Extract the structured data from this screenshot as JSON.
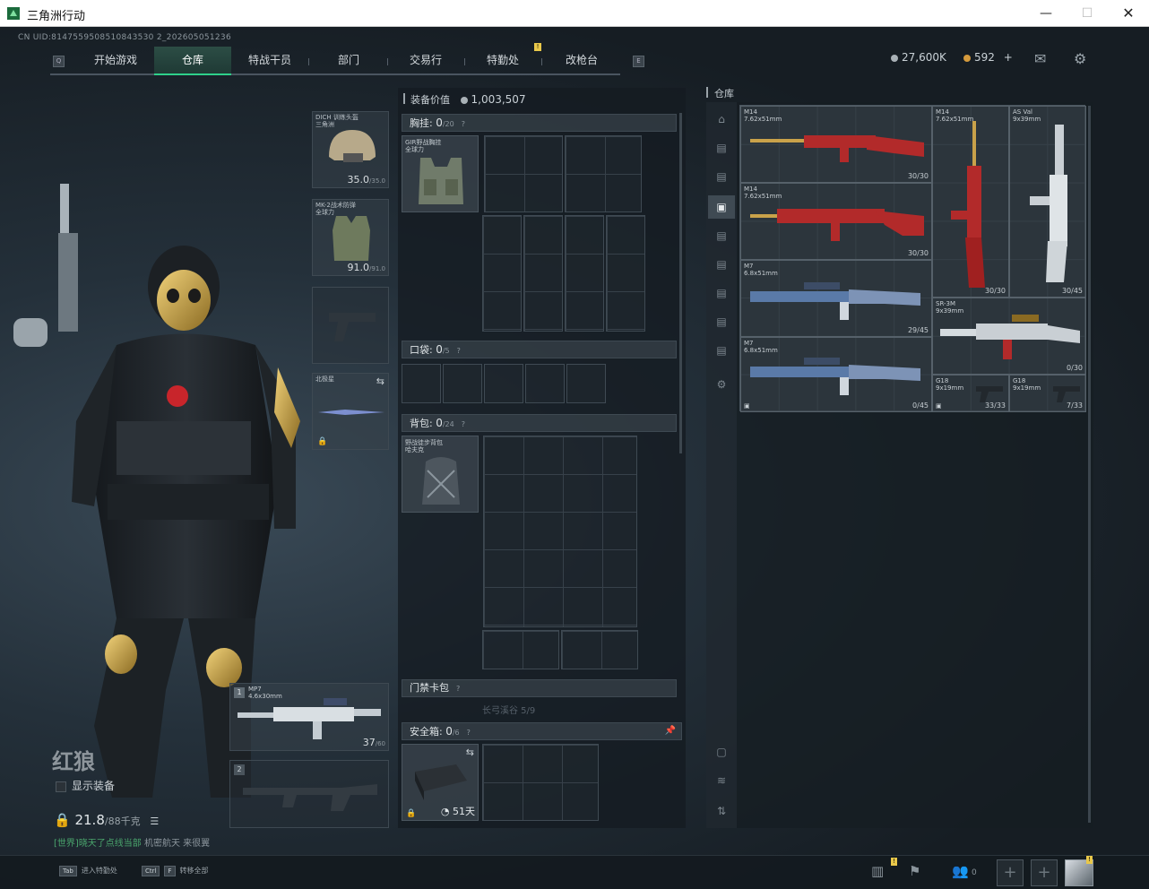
{
  "window": {
    "title": "三角洲行动",
    "min": "—",
    "max": "☐",
    "close": "✕"
  },
  "uid": "CN UID:8147559508510843530 2_202605051236",
  "nav": {
    "tabs": [
      "开始游戏",
      "仓库",
      "特战干员",
      "部门",
      "交易行",
      "特勤处",
      "改枪台"
    ],
    "active": "仓库",
    "badge": "!"
  },
  "currency": {
    "coins": "27,600K",
    "tickets": "592",
    "plus": "+"
  },
  "character": {
    "name": "红狼",
    "show_equip_label": "显示装备",
    "weight": "21.8",
    "weight_max": "/88千克",
    "ticker_prefix": "[世界]",
    "ticker_highlight": "晓天了点线当部",
    "ticker_rest": "机密航天 来很翼"
  },
  "equip_slots": {
    "helmet": {
      "name": "DICH 训练头盔\n三角洲",
      "dur": "35.0",
      "max": "/35.0"
    },
    "armor": {
      "name": "MK-2战术防弹\n全球力",
      "dur": "91.0",
      "max": "/91.0"
    },
    "melee": {
      "name": "北极星"
    },
    "primary": {
      "index": "1",
      "name": "MP7",
      "caliber": "4.6x30mm",
      "ammo": "37",
      "ammo_max": "/60"
    },
    "secondary": {
      "index": "2"
    }
  },
  "center": {
    "value_label": "装备价值",
    "value": "1,003,507",
    "chest_label": "胸挂:",
    "chest_count": "0",
    "chest_max": "/20",
    "chest_item": "GIR野战胸挂\n全球力",
    "pocket_label": "口袋:",
    "pocket_count": "0",
    "pocket_max": "/5",
    "backpack_label": "背包:",
    "backpack_count": "0",
    "backpack_max": "/24",
    "backpack_item": "野战徒步背包\n哈夫克",
    "keycard_label": "门禁卡包",
    "long_capacity": "长弓溪谷 5/9",
    "safe_label": "安全箱:",
    "safe_count": "0",
    "safe_max": "/6",
    "safe_days": "51天",
    "help": "?"
  },
  "warehouse": {
    "label": "仓库",
    "items": [
      {
        "name": "M14",
        "caliber": "7.62x51mm",
        "ammo": "30/30"
      },
      {
        "name": "M14",
        "caliber": "7.62x51mm",
        "ammo": "30/30"
      },
      {
        "name": "M14",
        "caliber": "7.62x51mm",
        "ammo": "30/30"
      },
      {
        "name": "AS Val",
        "caliber": "9x39mm",
        "ammo": "30/45"
      },
      {
        "name": "M7",
        "caliber": "6.8x51mm",
        "ammo": "29/45"
      },
      {
        "name": "SR-3M",
        "caliber": "9x39mm",
        "ammo": "0/30"
      },
      {
        "name": "M7",
        "caliber": "6.8x51mm",
        "ammo": "0/45"
      },
      {
        "name": "G18",
        "caliber": "9x19mm",
        "ammo": "33/33"
      },
      {
        "name": "G18",
        "caliber": "9x19mm",
        "ammo": "7/33"
      }
    ]
  },
  "bottom": {
    "tab_key": "Tab",
    "tab_hint": "进入特勤处",
    "ctrl_key": "Ctrl",
    "f_key": "F",
    "transfer_hint": "转移全部",
    "friends_count": "0",
    "plus": "+"
  }
}
